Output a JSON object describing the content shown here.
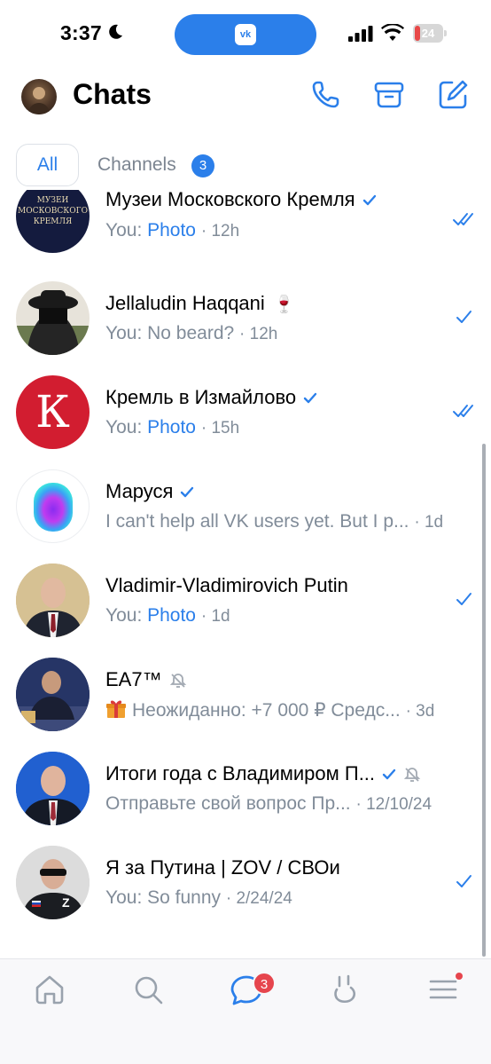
{
  "status_bar": {
    "time": "3:37",
    "battery": "24",
    "island_label": "vk"
  },
  "header": {
    "title": "Chats"
  },
  "tabs": {
    "all": "All",
    "channels": "Channels",
    "channels_badge": "3"
  },
  "chats": [
    {
      "name": "Музеи Московского Кремля",
      "prefix": "You: ",
      "message": "Photo",
      "time": "· 12h",
      "avatar_text": [
        "МУЗЕИ",
        "МОСКОВСКОГО",
        "КРЕМЛЯ"
      ]
    },
    {
      "name": "Jellaludin Haqqani",
      "prefix": "You: No beard?",
      "message": "",
      "time": "· 12h",
      "emoji": "🍷"
    },
    {
      "name": "Кремль в Измайлово",
      "prefix": "You: ",
      "message": "Photo",
      "time": "· 15h",
      "avatar_text": [
        "К"
      ]
    },
    {
      "name": "Маруся",
      "prefix": "I can't help all VK users yet. But I p...",
      "message": "",
      "time": "· 1d"
    },
    {
      "name": "Vladimir-Vladimirovich Putin",
      "prefix": "You: ",
      "message": "Photo",
      "time": "· 1d"
    },
    {
      "name": "EA7™",
      "prefix": "Неожиданно: +7 000 ₽ Средс...",
      "message": "",
      "time": "· 3d"
    },
    {
      "name": "Итоги года с Владимиром П...",
      "prefix": "Отправьте свой вопрос Пр...",
      "message": "",
      "time": "· 12/10/24"
    },
    {
      "name": "Я за Путина | ZOV / СВОи",
      "prefix": "You: So funny",
      "message": "",
      "time": "· 2/24/24",
      "avatar_text": [
        "Z"
      ]
    }
  ],
  "tabbar": {
    "messages_badge": "3"
  },
  "colors": {
    "accent": "#2b7fea",
    "secondary_text": "#818c99",
    "badge_red": "#e6454d"
  },
  "icons": {
    "header": [
      "phone-icon",
      "archive-icon",
      "compose-icon"
    ],
    "tabbar": [
      "home-icon",
      "search-icon",
      "messages-icon",
      "clips-icon",
      "menu-icon"
    ]
  }
}
